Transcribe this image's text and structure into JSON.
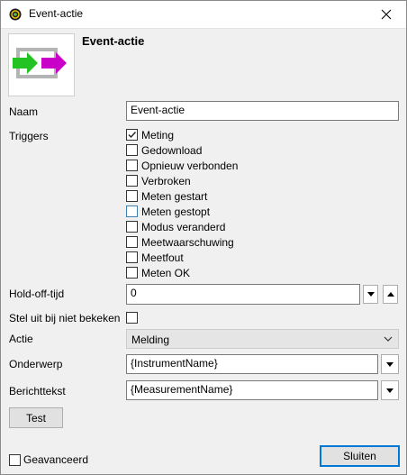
{
  "window": {
    "title": "Event-actie"
  },
  "header": {
    "heading": "Event-actie"
  },
  "form": {
    "name_label": "Naam",
    "name_value": "Event-actie",
    "triggers_label": "Triggers",
    "triggers": [
      {
        "label": "Meting",
        "checked": true
      },
      {
        "label": "Gedownload",
        "checked": false
      },
      {
        "label": "Opnieuw verbonden",
        "checked": false
      },
      {
        "label": "Verbroken",
        "checked": false
      },
      {
        "label": "Meten gestart",
        "checked": false
      },
      {
        "label": "Meten gestopt",
        "checked": false
      },
      {
        "label": "Modus veranderd",
        "checked": false
      },
      {
        "label": "Meetwaarschuwing",
        "checked": false
      },
      {
        "label": "Meetfout",
        "checked": false
      },
      {
        "label": "Meten OK",
        "checked": false
      }
    ],
    "holdoff_label": "Hold-off-tijd",
    "holdoff_value": "0",
    "disable_unwatched_label": "Stel uit bij niet bekeken",
    "disable_unwatched_checked": false,
    "action_label": "Actie",
    "action_value": "Melding",
    "subject_label": "Onderwerp",
    "subject_value": "{InstrumentName}",
    "message_label": "Berichttekst",
    "message_value": "{MeasurementName}"
  },
  "buttons": {
    "test": "Test",
    "close": "Sluiten"
  },
  "footer": {
    "advanced_label": "Geavanceerd",
    "advanced_checked": false
  },
  "colors": {
    "arrow_green": "#22c322",
    "arrow_magenta": "#c800c8",
    "accent": "#0078d7"
  }
}
